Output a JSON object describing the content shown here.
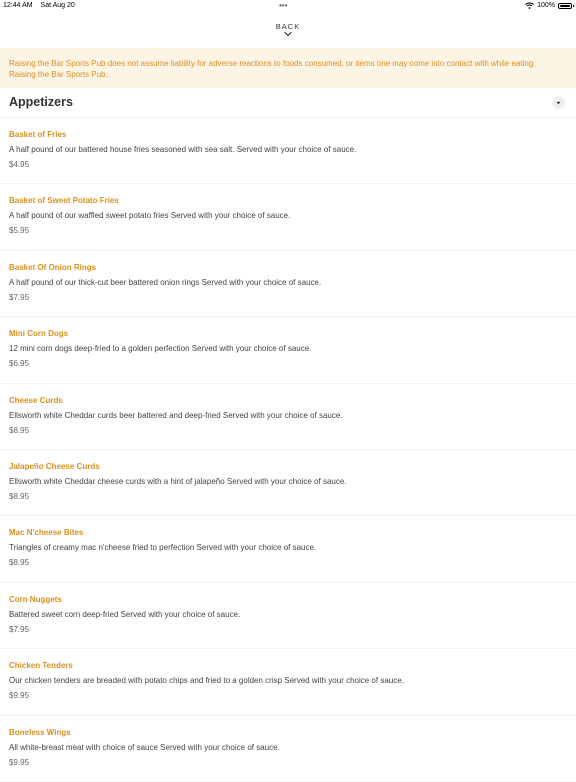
{
  "status_bar": {
    "time": "12:44 AM",
    "date": "Sat Aug 20",
    "dots": "•••",
    "battery_percent": "100%",
    "wifi_icon": "wifi-icon",
    "battery_icon": "battery-icon"
  },
  "nav": {
    "back_label": "BACK",
    "back_icon": "chevron-down-icon"
  },
  "disclaimer": {
    "line1": "Raising the Bar Sports Pub does not assume liability for adverse reactions to foods consumed, or items one may come into contact with while eating",
    "line2": "Raising the Bar Sports Pub."
  },
  "section": {
    "title": "Appetizers",
    "toggle_icon": "caret-down-icon"
  },
  "colors": {
    "accent": "#d9901f",
    "disclaimer_bg": "#fdf4e6"
  },
  "items": [
    {
      "name": "Basket of Fries",
      "description": "A half pound of our battered house fries seasoned with sea salt. Served with your choice of sauce.",
      "price": "$4.95"
    },
    {
      "name": "Basket of Sweet Potato Fries",
      "description": "A half pound of our waffled sweet potato fries Served with your choice of sauce.",
      "price": "$5.95"
    },
    {
      "name": "Basket Of Onion Rings",
      "description": "A half pound of our thick-cut beer battered onion rings Served with your choice of sauce.",
      "price": "$7.95"
    },
    {
      "name": "Mini Corn Dogs",
      "description": "12 mini corn dogs deep-fried to a golden perfection Served with your choice of sauce.",
      "price": "$6.95"
    },
    {
      "name": "Cheese Curds",
      "description": "Ellsworth white Cheddar curds beer battered and deep-fried Served with your choice of sauce.",
      "price": "$8.95"
    },
    {
      "name": "Jalapeño Cheese Curds",
      "description": "Ellsworth white Cheddar cheese curds with a hint of jalapeño Served with your choice of sauce.",
      "price": "$8.95"
    },
    {
      "name": "Mac N'cheese Bites",
      "description": "Triangles of creamy mac n'cheese fried to perfection Served with your choice of sauce.",
      "price": "$8.95"
    },
    {
      "name": "Corn Nuggets",
      "description": "Battered sweet corn deep-fried Served with your choice of sauce.",
      "price": "$7.95"
    },
    {
      "name": "Chicken Tenders",
      "description": "Our chicken tenders are breaded with potato chips and fried to a golden crisp Served with your choice of sauce.",
      "price": "$9.95"
    },
    {
      "name": "Boneless Wings",
      "description": "All white-breast meat with choice of sauce Served with your choice of sauce.",
      "price": "$9.95"
    }
  ]
}
